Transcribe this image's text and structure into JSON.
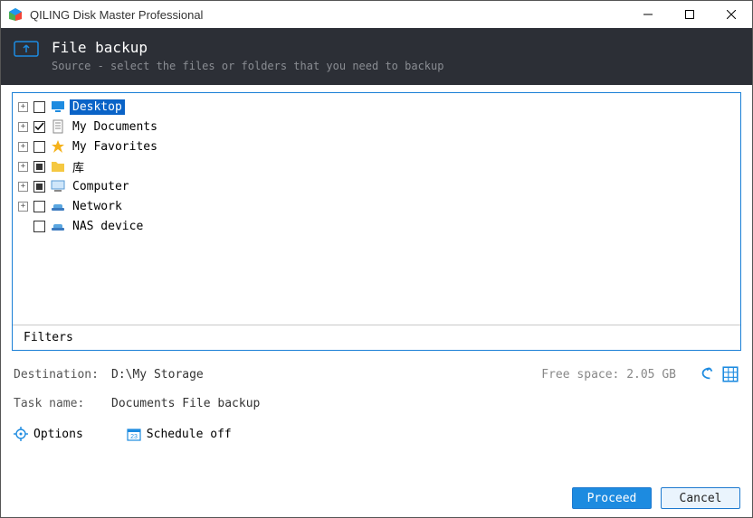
{
  "app": {
    "title": "QILING Disk Master Professional"
  },
  "header": {
    "title": "File backup",
    "subtitle": "Source - select the files or folders that you need to backup"
  },
  "tree": {
    "items": [
      {
        "label": "Desktop",
        "icon": "monitor",
        "expandable": true,
        "check": "unchecked",
        "selected": true
      },
      {
        "label": "My Documents",
        "icon": "document",
        "expandable": true,
        "check": "checked",
        "selected": false
      },
      {
        "label": "My Favorites",
        "icon": "star",
        "expandable": true,
        "check": "unchecked",
        "selected": false
      },
      {
        "label": "库",
        "icon": "folder",
        "expandable": true,
        "check": "partial",
        "selected": false
      },
      {
        "label": "Computer",
        "icon": "computer",
        "expandable": true,
        "check": "partial",
        "selected": false
      },
      {
        "label": "Network",
        "icon": "network",
        "expandable": true,
        "check": "unchecked",
        "selected": false
      },
      {
        "label": "NAS device",
        "icon": "network",
        "expandable": false,
        "check": "unchecked",
        "selected": false
      }
    ],
    "filters_label": "Filters"
  },
  "destination": {
    "label": "Destination:",
    "value": "D:\\My Storage",
    "free_space_label": "Free space: 2.05 GB"
  },
  "task": {
    "label": "Task name:",
    "value": "Documents File backup"
  },
  "bottom": {
    "options_label": "Options",
    "schedule_label": "Schedule off"
  },
  "buttons": {
    "proceed": "Proceed",
    "cancel": "Cancel"
  }
}
